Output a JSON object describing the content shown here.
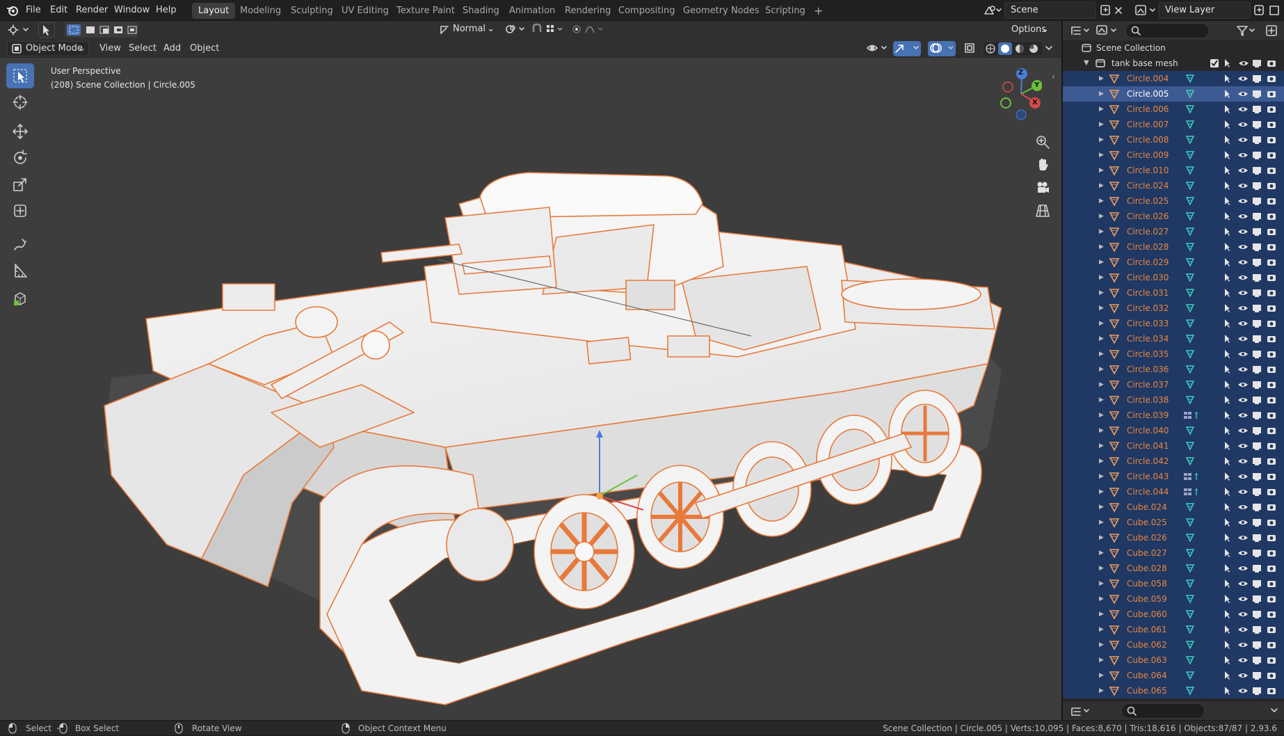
{
  "app": {
    "menu": [
      "File",
      "Edit",
      "Render",
      "Window",
      "Help"
    ],
    "workspaces": [
      "Layout",
      "Modeling",
      "Sculpting",
      "UV Editing",
      "Texture Paint",
      "Shading",
      "Animation",
      "Rendering",
      "Compositing",
      "Geometry Nodes",
      "Scripting"
    ],
    "active_workspace": "Layout",
    "scene_name": "Scene",
    "view_layer": "View Layer"
  },
  "viewport_header": {
    "orientation": "Normal",
    "options_label": "Options",
    "mode": "Object Mode",
    "menus": [
      "View",
      "Select",
      "Add",
      "Object"
    ]
  },
  "viewport": {
    "perspective": "User Perspective",
    "context": "(208) Scene Collection | Circle.005",
    "gizmo_axes": [
      "Z",
      "Y",
      "X"
    ]
  },
  "outliner": {
    "scene_collection": "Scene Collection",
    "collection": "tank base mesh",
    "selected_item": "Circle.005",
    "items": [
      {
        "name": "Circle.004",
        "mod": "mesh"
      },
      {
        "name": "Circle.005",
        "mod": "mesh"
      },
      {
        "name": "Circle.006",
        "mod": "mesh"
      },
      {
        "name": "Circle.007",
        "mod": "mesh"
      },
      {
        "name": "Circle.008",
        "mod": "mesh"
      },
      {
        "name": "Circle.009",
        "mod": "mesh"
      },
      {
        "name": "Circle.010",
        "mod": "mesh"
      },
      {
        "name": "Circle.024",
        "mod": "mesh"
      },
      {
        "name": "Circle.025",
        "mod": "mesh"
      },
      {
        "name": "Circle.026",
        "mod": "mesh"
      },
      {
        "name": "Circle.027",
        "mod": "mesh"
      },
      {
        "name": "Circle.028",
        "mod": "mesh"
      },
      {
        "name": "Circle.029",
        "mod": "mesh"
      },
      {
        "name": "Circle.030",
        "mod": "mesh"
      },
      {
        "name": "Circle.031",
        "mod": "mesh"
      },
      {
        "name": "Circle.032",
        "mod": "mesh"
      },
      {
        "name": "Circle.033",
        "mod": "mesh"
      },
      {
        "name": "Circle.034",
        "mod": "mesh"
      },
      {
        "name": "Circle.035",
        "mod": "mesh"
      },
      {
        "name": "Circle.036",
        "mod": "mesh"
      },
      {
        "name": "Circle.037",
        "mod": "mesh"
      },
      {
        "name": "Circle.038",
        "mod": "mesh"
      },
      {
        "name": "Circle.039",
        "mod": "modifier"
      },
      {
        "name": "Circle.040",
        "mod": "mesh"
      },
      {
        "name": "Circle.041",
        "mod": "mesh"
      },
      {
        "name": "Circle.042",
        "mod": "mesh"
      },
      {
        "name": "Circle.043",
        "mod": "modifier"
      },
      {
        "name": "Circle.044",
        "mod": "modifier"
      },
      {
        "name": "Cube.024",
        "mod": "mesh"
      },
      {
        "name": "Cube.025",
        "mod": "mesh"
      },
      {
        "name": "Cube.026",
        "mod": "mesh"
      },
      {
        "name": "Cube.027",
        "mod": "mesh"
      },
      {
        "name": "Cube.028",
        "mod": "mesh"
      },
      {
        "name": "Cube.058",
        "mod": "mesh"
      },
      {
        "name": "Cube.059",
        "mod": "mesh"
      },
      {
        "name": "Cube.060",
        "mod": "mesh"
      },
      {
        "name": "Cube.061",
        "mod": "mesh"
      },
      {
        "name": "Cube.062",
        "mod": "mesh"
      },
      {
        "name": "Cube.063",
        "mod": "mesh"
      },
      {
        "name": "Cube.064",
        "mod": "mesh"
      },
      {
        "name": "Cube.065",
        "mod": "mesh"
      }
    ]
  },
  "statusbar": {
    "select": "Select",
    "box_select": "Box Select",
    "rotate_view": "Rotate View",
    "context_menu": "Object Context Menu",
    "stats": "Scene Collection | Circle.005 | Verts:10,095 | Faces:8,670 | Tris:18,616 | Objects:87/87 | 2.93.6"
  },
  "colors": {
    "accent": "#4772b3",
    "selection_outline": "#e8793a",
    "selected_row": "#334d80",
    "item_text": "#e8883e"
  }
}
